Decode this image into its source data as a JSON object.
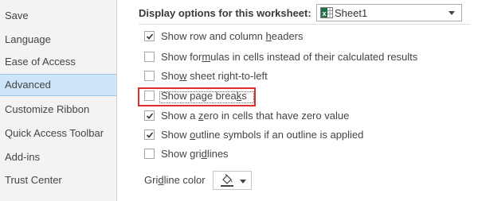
{
  "sidebar": {
    "items": [
      {
        "label": "Save",
        "selected": false
      },
      {
        "label": "Language",
        "selected": false
      },
      {
        "label": "Ease of Access",
        "selected": false
      },
      {
        "label": "Advanced",
        "selected": true
      },
      {
        "label": "Customize Ribbon",
        "selected": false
      },
      {
        "label": "Quick Access Toolbar",
        "selected": false
      },
      {
        "label": "Add-ins",
        "selected": false
      },
      {
        "label": "Trust Center",
        "selected": false
      }
    ]
  },
  "section": {
    "header": "Display options for this worksheet:",
    "sheet_select": {
      "value": "Sheet1",
      "icon": "excel-sheet-icon"
    }
  },
  "options": [
    {
      "label_pre": "Show row and column ",
      "label_u": "h",
      "label_post": "eaders",
      "checked": true
    },
    {
      "label_pre": "Show for",
      "label_u": "m",
      "label_post": "ulas in cells instead of their calculated results",
      "checked": false
    },
    {
      "label_pre": "Sho",
      "label_u": "w",
      "label_post": " sheet right-to-left",
      "checked": false
    },
    {
      "label_pre": "Show page brea",
      "label_u": "k",
      "label_post": "s",
      "checked": false
    },
    {
      "label_pre": "Show a ",
      "label_u": "z",
      "label_post": "ero in cells that have zero value",
      "checked": true
    },
    {
      "label_pre": "Show ",
      "label_u": "o",
      "label_post": "utline symbols if an outline is applied",
      "checked": true
    },
    {
      "label_pre": "Show gri",
      "label_u": "d",
      "label_post": "lines",
      "checked": false
    }
  ],
  "gridline": {
    "label_pre": "Gri",
    "label_u": "d",
    "label_post": "line color",
    "icon": "paint-bucket-icon"
  },
  "colors": {
    "highlight": "#e02d2d",
    "selected_bg": "#cde6f7",
    "sidebar_bg": "#f3f3f3"
  }
}
